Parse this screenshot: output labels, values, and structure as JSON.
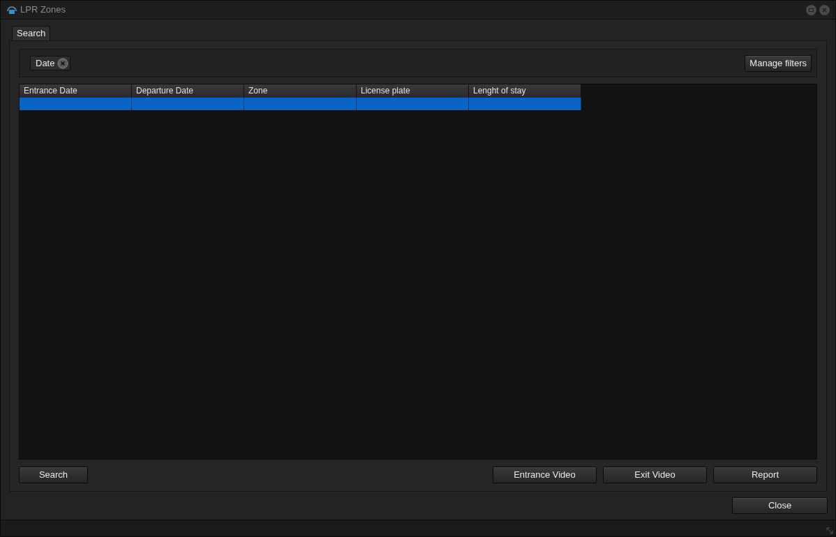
{
  "window": {
    "title": "LPR Zones"
  },
  "tabs": [
    {
      "label": "Search",
      "selected": true
    }
  ],
  "filters": [
    {
      "label": "Date"
    }
  ],
  "manage_filters_button": "Manage filters",
  "table": {
    "columns": [
      "Entrance Date",
      "Departure Date",
      "Zone",
      "License plate",
      "Lenght of stay"
    ],
    "rows": [
      {
        "selected": true
      }
    ]
  },
  "search_button": "Search",
  "action_buttons": [
    "Entrance Video",
    "Exit Video",
    "Report"
  ],
  "close_button": "Close"
}
